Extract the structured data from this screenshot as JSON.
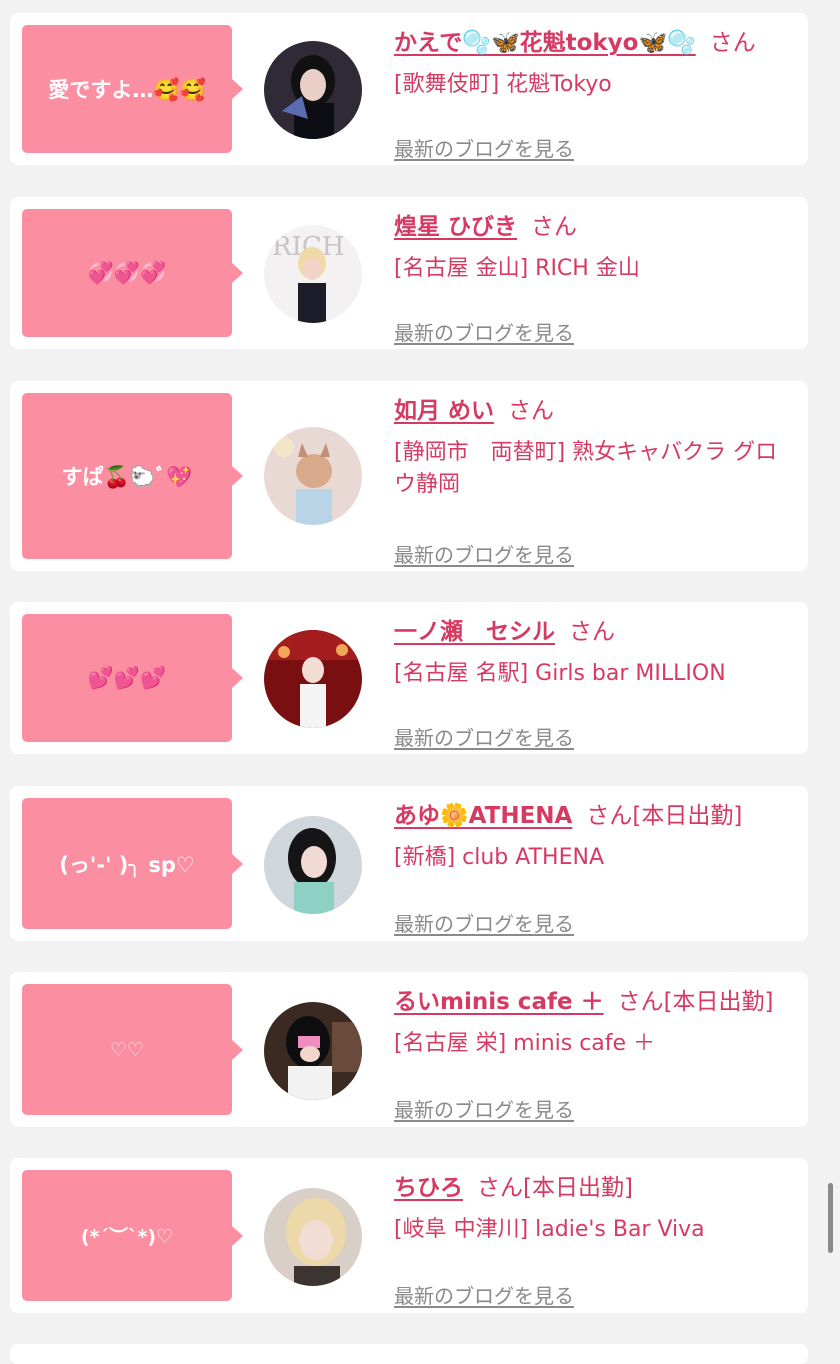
{
  "blog_link_label": "最新のブログを見る",
  "honorific": "さん",
  "colors": {
    "bubble": "#fc8ea1",
    "accent": "#d63a63",
    "link_gray": "#8a8a8a",
    "page_bg": "#f2f2f2"
  },
  "cards": [
    {
      "message": "愛ですよ…🥰🥰",
      "name": "かえで🫧🦋花魁tokyo🦋🫧",
      "shift": "",
      "shop": "[歌舞伎町] 花魁Tokyo",
      "avatar": "avatar-photo-woman-dark-hair"
    },
    {
      "message": "💞💞💞",
      "name": "煌星 ひびき",
      "shift": "",
      "shop": "[名古屋 金山] RICH 金山",
      "avatar": "avatar-photo-magazine-cover"
    },
    {
      "message": "すぱ🍒🐑ﾞ💖",
      "name": "如月 めい",
      "shift": "",
      "shop": "[静岡市　両替町] 熟女キャバクラ グロウ静岡",
      "avatar": "avatar-photo-cat-filter"
    },
    {
      "message": "💕💕💕",
      "name": "一ノ瀬　セシル",
      "shift": "",
      "shop": "[名古屋 名駅] Girls bar MILLION",
      "avatar": "avatar-photo-red-room"
    },
    {
      "message": "(っ'-' )╮ sp♡",
      "name": "あゆ🌼ATHENA",
      "shift": "[本日出勤]",
      "shop": "[新橋] club ATHENA",
      "avatar": "avatar-photo-woman-black-hair"
    },
    {
      "message": "♡♡",
      "name": "るいminis cafe ＋",
      "shift": "[本日出勤]",
      "shop": "[名古屋 栄] minis cafe ＋",
      "avatar": "avatar-photo-maid-cafe"
    },
    {
      "message": "(*´︶`*)♡",
      "name": "ちひろ",
      "shift": "[本日出勤]",
      "shop": "[岐阜 中津川] ladie's Bar Viva",
      "avatar": "avatar-photo-blonde-woman"
    }
  ]
}
